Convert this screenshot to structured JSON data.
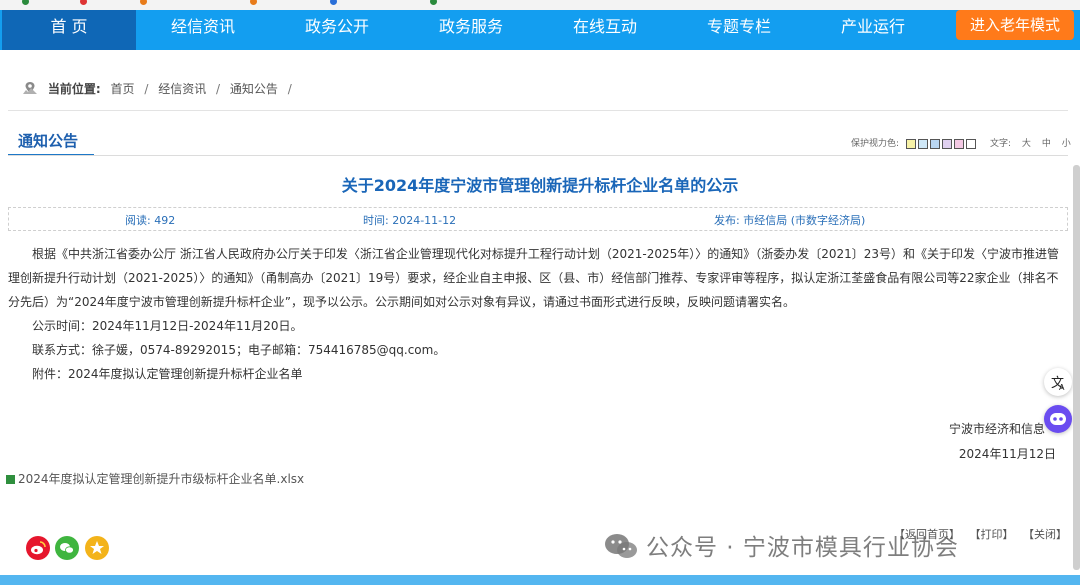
{
  "nav": {
    "items": [
      "首 页",
      "经信资讯",
      "政务公开",
      "政务服务",
      "在线互动",
      "专题专栏",
      "产业运行"
    ],
    "elder_mode": "进入老年模式"
  },
  "breadcrumb": {
    "label": "当前位置:",
    "items": [
      "首页",
      "经信资讯",
      "通知公告"
    ]
  },
  "section": {
    "title": "通知公告",
    "vision_label": "保护视力色:",
    "vision_colors": [
      "#f8f3a8",
      "#cfe8f8",
      "#b9d6f2",
      "#e0d0f0",
      "#f4c9e4",
      "#ffffff"
    ],
    "font_label": "文字:",
    "font_sizes": [
      "大",
      "中",
      "小"
    ]
  },
  "article": {
    "title": "关于2024年度宁波市管理创新提升标杆企业名单的公示",
    "reads": "阅读: 492",
    "time": "时间: 2024-11-12",
    "publisher": "发布: 市经信局 (市数字经济局)",
    "paragraphs": [
      "根据《中共浙江省委办公厅 浙江省人民政府办公厅关于印发〈浙江省企业管理现代化对标提升工程行动计划（2021-2025年）〉的通知》（浙委办发〔2021〕23号）和《关于印发〈宁波市推进管理创新提升行动计划（2021-2025）〉的通知》（甬制高办〔2021〕19号）要求，经企业自主申报、区（县、市）经信部门推荐、专家评审等程序，拟认定浙江荃盛食品有限公司等22家企业（排名不分先后）为“2024年度宁波市管理创新提升标杆企业”，现予以公示。公示期间如对公示对象有异议，请通过书面形式进行反映，反映问题请署实名。",
      "公示时间：2024年11月12日-2024年11月20日。",
      "联系方式：徐子媛，0574-89292015；电子邮箱：754416785@qq.com。",
      "附件：2024年度拟认定管理创新提升标杆企业名单"
    ],
    "signature": "宁波市经济和信息",
    "sign_date": "2024年11月12日",
    "attachment": "2024年度拟认定管理创新提升市级标杆企业名单.xlsx"
  },
  "footer": {
    "links": [
      "【返回首页】",
      "【打印】",
      "【关闭】"
    ],
    "watermark": "公众号 · 宁波市模具行业协会"
  },
  "colors": {
    "nav_bg": "#139ef0",
    "nav_active": "#0f67b6",
    "elder_btn": "#ff7a1a",
    "title_blue": "#1a66b8"
  },
  "icons": {
    "breadcrumb": "location-pin-icon",
    "share": [
      "weibo-icon",
      "wechat-icon",
      "qzone-icon"
    ],
    "side": [
      "translate-icon",
      "assistant-icon"
    ]
  }
}
